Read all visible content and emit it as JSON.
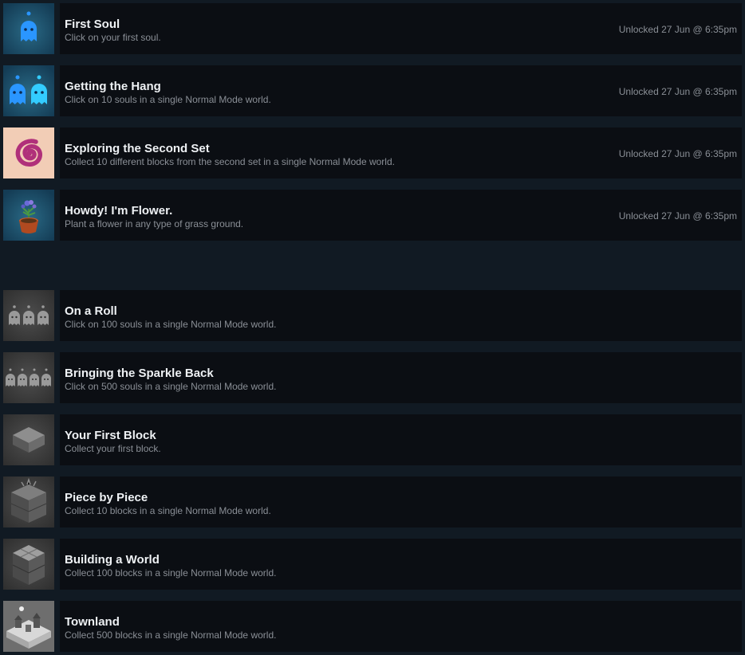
{
  "unlocked_achievements": [
    {
      "title": "First Soul",
      "description": "Click on your first soul.",
      "unlock_time": "Unlocked 27 Jun @ 6:35pm",
      "icon": "one-blue-soul-icon"
    },
    {
      "title": "Getting the Hang",
      "description": "Click on 10 souls in a single Normal Mode world.",
      "unlock_time": "Unlocked 27 Jun @ 6:35pm",
      "icon": "two-blue-souls-icon"
    },
    {
      "title": "Exploring the Second Set",
      "description": "Collect 10 different blocks from the second set in a single Normal Mode world.",
      "unlock_time": "Unlocked 27 Jun @ 6:35pm",
      "icon": "pink-spiral-icon"
    },
    {
      "title": "Howdy! I'm Flower.",
      "description": "Plant a flower in any type of grass ground.",
      "unlock_time": "Unlocked 27 Jun @ 6:35pm",
      "icon": "flower-pot-icon"
    }
  ],
  "locked_achievements": [
    {
      "title": "On a Roll",
      "description": "Click on 100 souls in a single Normal Mode world.",
      "icon": "three-grey-souls-icon"
    },
    {
      "title": "Bringing the Sparkle Back",
      "description": "Click on 500 souls in a single Normal Mode world.",
      "icon": "four-grey-souls-icon"
    },
    {
      "title": "Your First Block",
      "description": "Collect your first block.",
      "icon": "single-block-icon"
    },
    {
      "title": "Piece by Piece",
      "description": "Collect 10 blocks in a single Normal Mode world.",
      "icon": "block-stack-icon"
    },
    {
      "title": "Building a World",
      "description": "Collect 100 blocks in a single Normal Mode world.",
      "icon": "block-tower-icon"
    },
    {
      "title": "Townland",
      "description": "Collect 500 blocks in a single Normal Mode world.",
      "icon": "town-island-icon"
    }
  ],
  "colors": {
    "page_bg": "#111a23",
    "row_bg": "#0b0e13",
    "title": "#eef1f4",
    "muted": "#8a8f96",
    "soul_blue": "#1e90ff",
    "soul_cyan": "#33ccff"
  }
}
